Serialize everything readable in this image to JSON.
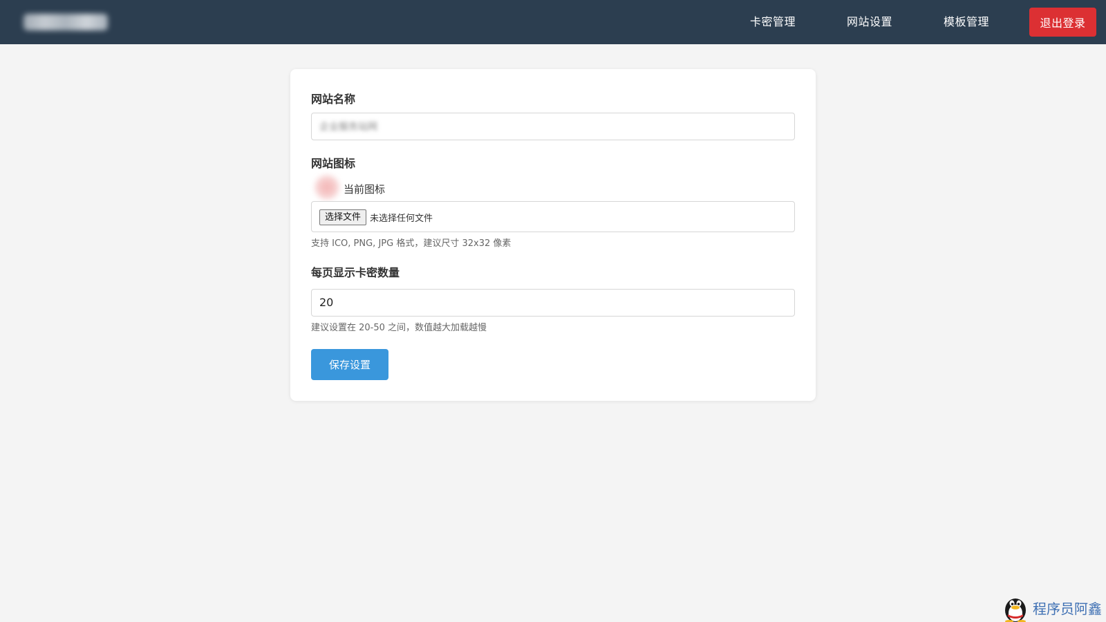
{
  "navbar": {
    "links": [
      "卡密管理",
      "网站设置",
      "模板管理"
    ],
    "logout_label": "退出登录"
  },
  "form": {
    "site_name": {
      "label": "网站名称",
      "value": "企业服务站网"
    },
    "site_icon": {
      "label": "网站图标",
      "current_caption": "当前图标",
      "file_button_label": "选择文件",
      "file_status": "未选择任何文件",
      "help": "支持 ICO, PNG, JPG 格式，建议尺寸 32x32 像素"
    },
    "per_page": {
      "label": "每页显示卡密数量",
      "value": "20",
      "help": "建议设置在 20-50 之间，数值越大加载越慢"
    },
    "save_label": "保存设置"
  },
  "watermark": {
    "text": "程序员阿鑫",
    "icon": "penguin-icon"
  },
  "colors": {
    "navbar": "#2c3e50",
    "logout": "#dc3033",
    "primary": "#3a97dc",
    "background": "#f4f4f4"
  }
}
